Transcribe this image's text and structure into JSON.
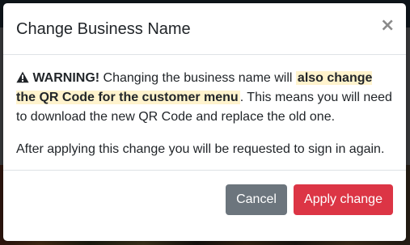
{
  "modal": {
    "title": "Change Business Name",
    "close_symbol": "×",
    "body": {
      "warning_label": "WARNING!",
      "warning_text_1": " Changing the business name will ",
      "warning_highlight": "also change the QR Code for the customer menu",
      "warning_text_2": ". This means you will need to download the new QR Code and replace the old one.",
      "info_text": "After applying this change you will be requested to sign in again."
    },
    "footer": {
      "cancel_label": "Cancel",
      "apply_label": "Apply change"
    },
    "icons": {
      "warning": "exclamation-triangle-icon",
      "close": "close-icon"
    }
  },
  "colors": {
    "cancel_button": "#6c757d",
    "apply_button": "#dc3545",
    "highlight": "#fff3cd"
  }
}
